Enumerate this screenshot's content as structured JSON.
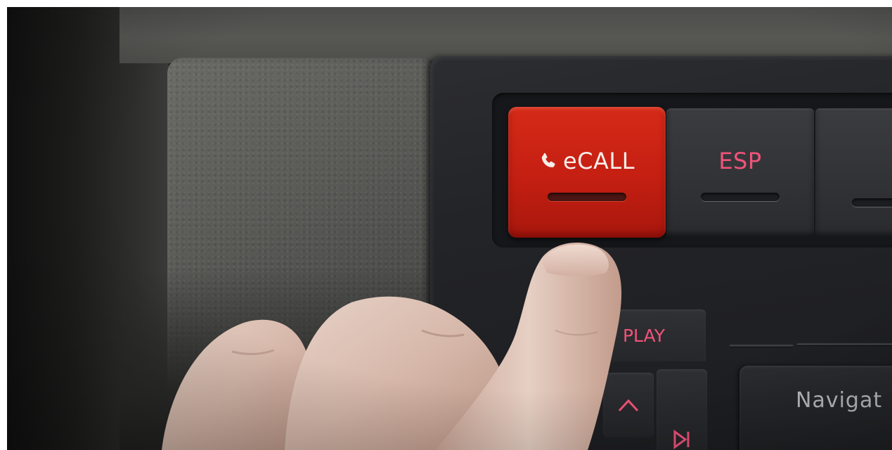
{
  "scene": {
    "description_label": ""
  },
  "buttons": {
    "ecall": {
      "label": "eCALL",
      "icon": "phone-icon",
      "color": "#c41f12"
    },
    "esp": {
      "label": "ESP",
      "color": "#f0537a"
    },
    "display": {
      "label": "PLAY"
    },
    "navigation": {
      "label": "Navigat"
    },
    "up": {
      "icon": "chevron-up-icon"
    },
    "skip": {
      "icon": "skip-forward-icon"
    }
  },
  "colors": {
    "accent_red": "#c41f12",
    "label_pink": "#f0537a",
    "console": "#232428",
    "leather": "#5a5b57"
  }
}
